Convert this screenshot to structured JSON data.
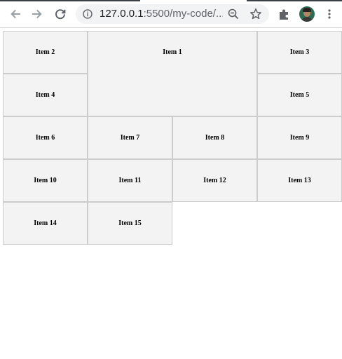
{
  "browser": {
    "url_host": "127.0.0.1",
    "url_rest": ":5500/my-code/...",
    "icons": {
      "back": "arrow-left-icon",
      "forward": "arrow-right-icon",
      "reload": "reload-icon",
      "site_info": "info-icon",
      "zoom": "zoom-out-icon",
      "bookmark": "star-icon",
      "extensions": "puzzle-icon",
      "profile": "avatar",
      "menu": "kebab-menu-icon"
    }
  },
  "grid": {
    "items": [
      {
        "label": "Item 1"
      },
      {
        "label": "Item 2"
      },
      {
        "label": "Item 3"
      },
      {
        "label": "Item 4"
      },
      {
        "label": "Item 5"
      },
      {
        "label": "Item 6"
      },
      {
        "label": "Item 7"
      },
      {
        "label": "Item 8"
      },
      {
        "label": "Item 9"
      },
      {
        "label": "Item 10"
      },
      {
        "label": "Item 11"
      },
      {
        "label": "Item 12"
      },
      {
        "label": "Item 13"
      },
      {
        "label": "Item 14"
      },
      {
        "label": "Item 15"
      }
    ]
  }
}
